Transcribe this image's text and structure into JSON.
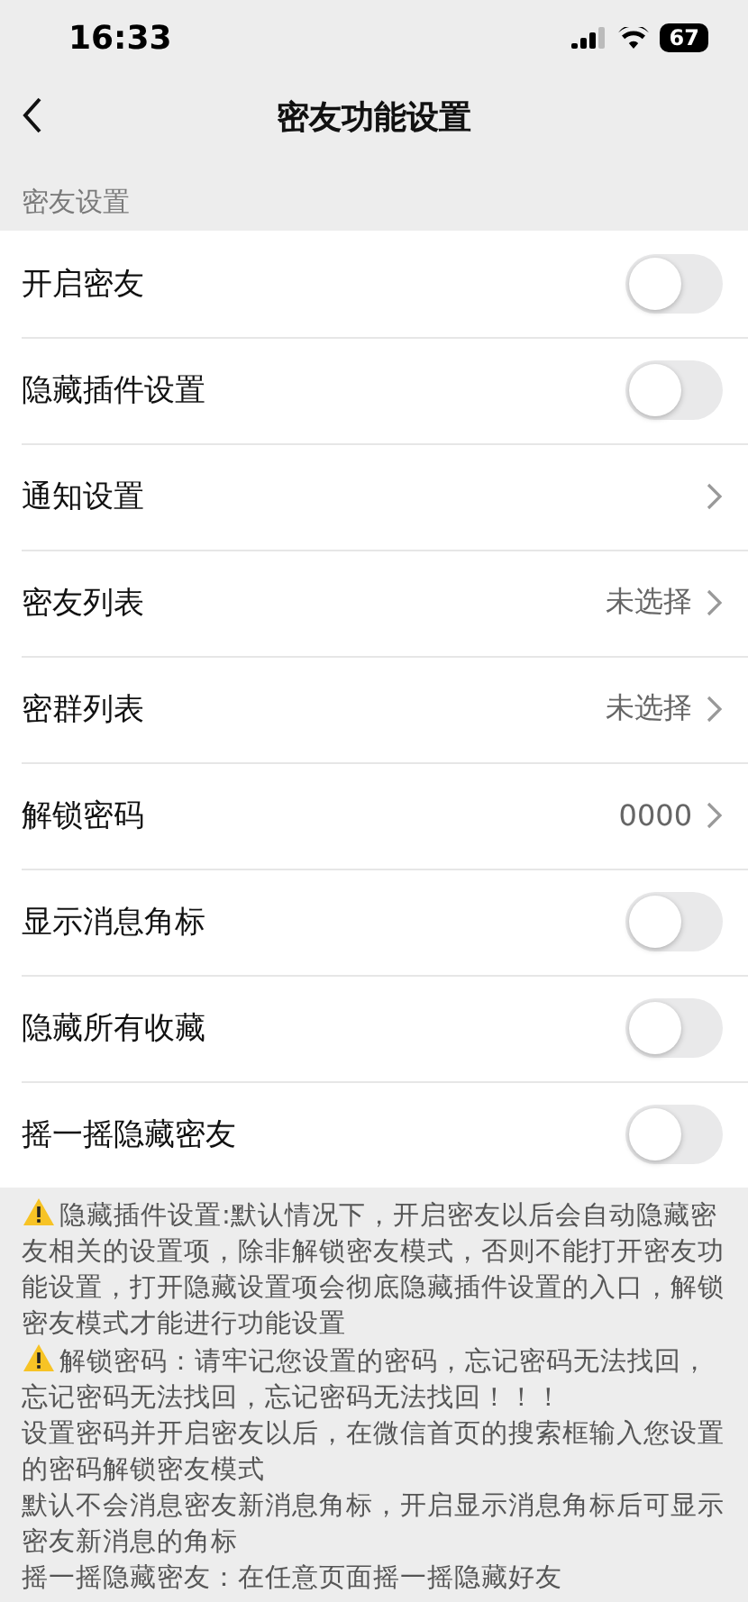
{
  "status_bar": {
    "time": "16:33",
    "battery": "67"
  },
  "nav": {
    "title": "密友功能设置"
  },
  "section": {
    "title": "密友设置"
  },
  "rows": [
    {
      "kind": "toggle",
      "label": "开启密友",
      "on": false
    },
    {
      "kind": "toggle",
      "label": "隐藏插件设置",
      "on": false
    },
    {
      "kind": "link",
      "label": "通知设置"
    },
    {
      "kind": "link",
      "label": "密友列表",
      "value": "未选择"
    },
    {
      "kind": "link",
      "label": "密群列表",
      "value": "未选择"
    },
    {
      "kind": "link",
      "label": "解锁密码",
      "value": "0000"
    },
    {
      "kind": "toggle",
      "label": "显示消息角标",
      "on": false
    },
    {
      "kind": "toggle",
      "label": "隐藏所有收藏",
      "on": false
    },
    {
      "kind": "toggle",
      "label": "摇一摇隐藏密友",
      "on": false
    }
  ],
  "notes": [
    {
      "warning": true,
      "text": "隐藏插件设置:默认情况下，开启密友以后会自动隐藏密友相关的设置项，除非解锁密友模式，否则不能打开密友功能设置，打开隐藏设置项会彻底隐藏插件设置的入口，解锁密友模式才能进行功能设置"
    },
    {
      "warning": true,
      "text": "解锁密码：请牢记您设置的密码，忘记密码无法找回，忘记密码无法找回，忘记密码无法找回！！！"
    },
    {
      "warning": false,
      "text": "设置密码并开启密友以后，在微信首页的搜索框输入您设置的密码解锁密友模式"
    },
    {
      "warning": false,
      "text": "默认不会消息密友新消息角标，开启显示消息角标后可显示密友新消息的角标"
    },
    {
      "warning": false,
      "text": "摇一摇隐藏密友：在任意页面摇一摇隐藏好友"
    }
  ]
}
